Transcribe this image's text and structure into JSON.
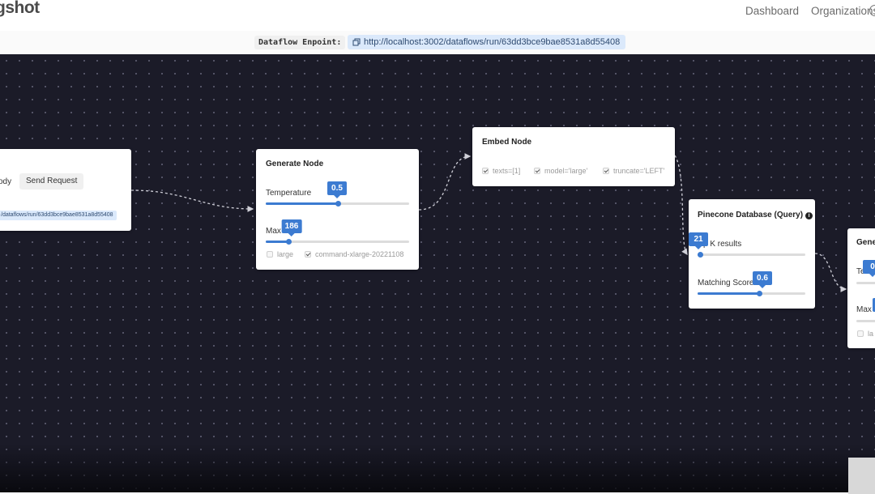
{
  "app": {
    "brand": "gshot"
  },
  "nav": {
    "dashboard": "Dashboard",
    "organizations": "Organizations"
  },
  "endpoint": {
    "label": "Dataflow Enpoint:",
    "url": "http://localhost:3002/dataflows/run/63dd3bce9bae8531a8d55408"
  },
  "request_node": {
    "body_tab": "ody",
    "send_tab": "Send Request",
    "url": "/dataflows/run/63dd3bce9bae8531a8d55408"
  },
  "generate_node": {
    "title": "Generate Node",
    "temperature_label": "Temperature",
    "temperature_value": "0.5",
    "temperature_fraction": 0.5,
    "max_tokens_label": "Max",
    "max_tokens_value": "186",
    "max_tokens_fraction": 0.16,
    "options": [
      {
        "label": "large",
        "checked": false
      },
      {
        "label": "command-xlarge-20221108",
        "checked": true
      }
    ]
  },
  "embed_node": {
    "title": "Embed Node",
    "options": [
      {
        "label": "texts=[1]",
        "checked": true
      },
      {
        "label": "model='large'",
        "checked": true
      },
      {
        "label": "truncate='LEFT'",
        "checked": true
      }
    ]
  },
  "pinecone_node": {
    "title": "Pinecone Database (Query)",
    "info_icon": "i",
    "topk_label": "p K results",
    "topk_value": "21",
    "topk_fraction": 0.02,
    "score_label": "Matching Score",
    "score_value": "0.6",
    "score_fraction": 0.57
  },
  "generate_node_2": {
    "title": "Gene",
    "temperature_label": "Ten",
    "temperature_value": "0",
    "max_tokens_label": "Max",
    "option_label": "la"
  },
  "colors": {
    "canvas": "#1b1b28",
    "accent": "#3c7bd1",
    "endpoint_bg": "#dbe9fb"
  }
}
